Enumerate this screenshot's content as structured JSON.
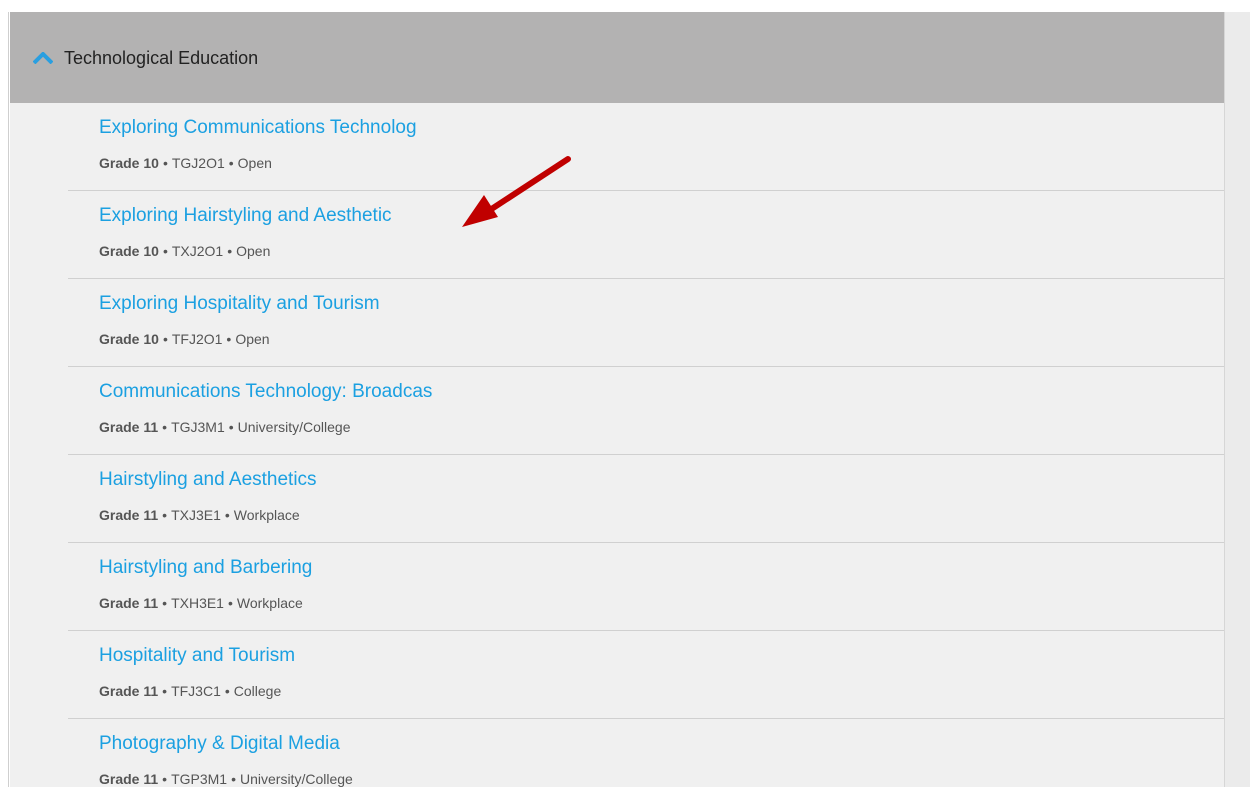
{
  "section": {
    "title": "Technological Education",
    "expanded": true,
    "chevron_icon": "chevron-up-icon",
    "accent_color": "#1ba0e1"
  },
  "courses": [
    {
      "title": "Exploring Communications Technolog",
      "grade": "Grade 10",
      "code": "TGJ2O1",
      "pathway": "Open"
    },
    {
      "title": "Exploring Hairstyling and Aesthetic",
      "grade": "Grade 10",
      "code": "TXJ2O1",
      "pathway": "Open"
    },
    {
      "title": "Exploring Hospitality and Tourism",
      "grade": "Grade 10",
      "code": "TFJ2O1",
      "pathway": "Open"
    },
    {
      "title": "Communications Technology: Broadcas",
      "grade": "Grade 11",
      "code": "TGJ3M1",
      "pathway": "University/College"
    },
    {
      "title": "Hairstyling and Aesthetics",
      "grade": "Grade 11",
      "code": "TXJ3E1",
      "pathway": "Workplace"
    },
    {
      "title": "Hairstyling and Barbering",
      "grade": "Grade 11",
      "code": "TXH3E1",
      "pathway": "Workplace"
    },
    {
      "title": "Hospitality and Tourism",
      "grade": "Grade 11",
      "code": "TFJ3C1",
      "pathway": "College"
    },
    {
      "title": "Photography & Digital Media",
      "grade": "Grade 11",
      "code": "TGP3M1",
      "pathway": "University/College"
    }
  ],
  "meta_separator": "•",
  "annotation": {
    "type": "arrow",
    "color": "#c00000",
    "points_to": "Exploring Hairstyling and Aesthetic"
  }
}
